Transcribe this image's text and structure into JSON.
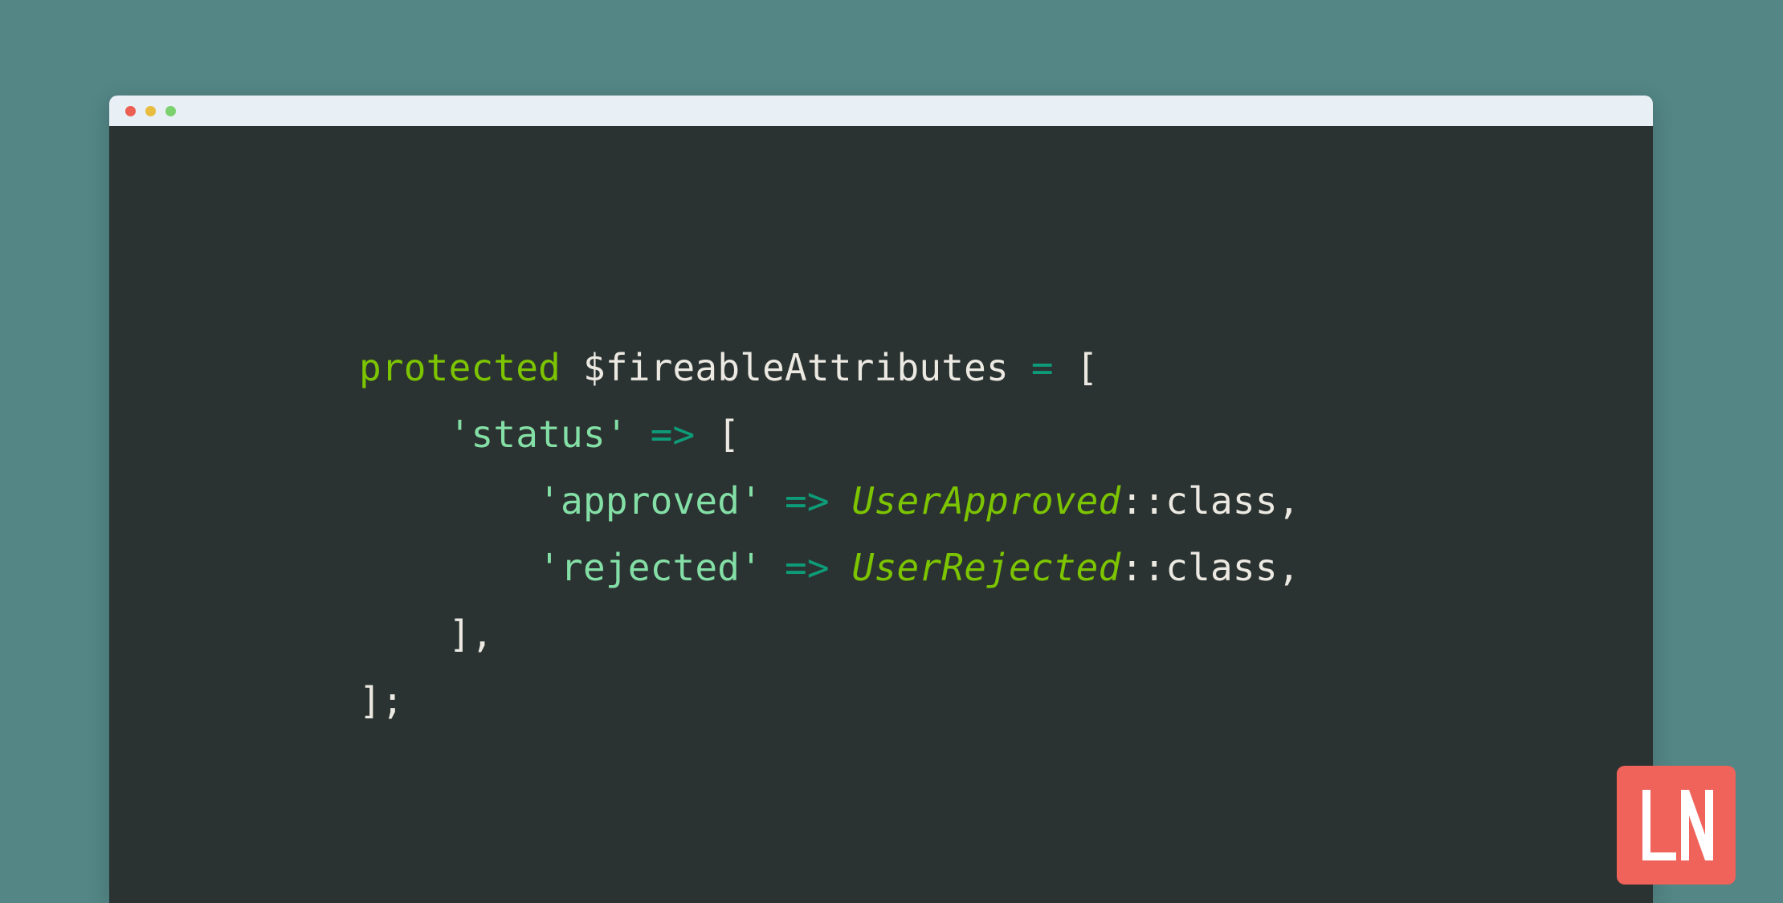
{
  "background": {
    "color": "#538685"
  },
  "window": {
    "titlebar": {
      "background": "#e8eff5",
      "buttons": [
        {
          "name": "close",
          "color": "#ec5f52"
        },
        {
          "name": "minimize",
          "color": "#e8bc3e"
        },
        {
          "name": "maximize",
          "color": "#7cd16f"
        }
      ]
    },
    "editor": {
      "background": "#2a3331",
      "language": "php",
      "theme_colors": {
        "keyword": "#7dc400",
        "plain": "#ece9e2",
        "operator": "#0e9b78",
        "string": "#84dfa6",
        "class": "#7dc400"
      },
      "code_lines": [
        {
          "indent": "",
          "tokens": [
            {
              "type": "keyword",
              "text": "protected"
            },
            {
              "type": "plain",
              "text": " $fireableAttributes "
            },
            {
              "type": "operator",
              "text": "="
            },
            {
              "type": "plain",
              "text": " "
            },
            {
              "type": "punct",
              "text": "["
            }
          ]
        },
        {
          "indent": "    ",
          "tokens": [
            {
              "type": "string",
              "text": "'status'"
            },
            {
              "type": "plain",
              "text": " "
            },
            {
              "type": "operator",
              "text": "=>"
            },
            {
              "type": "plain",
              "text": " "
            },
            {
              "type": "punct",
              "text": "["
            }
          ]
        },
        {
          "indent": "        ",
          "tokens": [
            {
              "type": "string",
              "text": "'approved'"
            },
            {
              "type": "plain",
              "text": " "
            },
            {
              "type": "operator",
              "text": "=>"
            },
            {
              "type": "plain",
              "text": " "
            },
            {
              "type": "class",
              "text": "UserApproved"
            },
            {
              "type": "plain",
              "text": "::class,"
            }
          ]
        },
        {
          "indent": "        ",
          "tokens": [
            {
              "type": "string",
              "text": "'rejected'"
            },
            {
              "type": "plain",
              "text": " "
            },
            {
              "type": "operator",
              "text": "=>"
            },
            {
              "type": "plain",
              "text": " "
            },
            {
              "type": "class",
              "text": "UserRejected"
            },
            {
              "type": "plain",
              "text": "::class,"
            }
          ]
        },
        {
          "indent": "    ",
          "tokens": [
            {
              "type": "punct",
              "text": "],"
            }
          ]
        },
        {
          "indent": "",
          "tokens": [
            {
              "type": "punct",
              "text": "];"
            }
          ]
        }
      ]
    }
  },
  "logo": {
    "text": "LN",
    "background": "#ef635a",
    "foreground": "#ffffff"
  }
}
